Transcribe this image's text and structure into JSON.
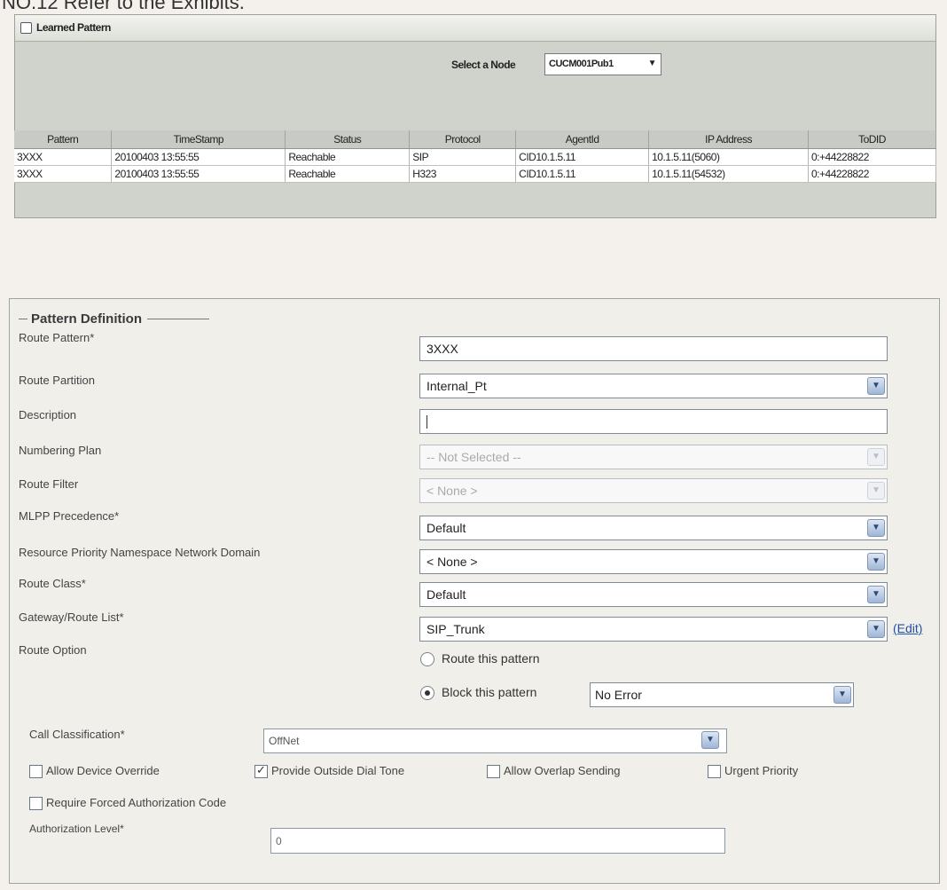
{
  "caption": "NO.12 Refer to the Exhibits.",
  "learned_pattern": {
    "title": "Learned Pattern",
    "node_label": "Select a Node",
    "node_value": "CUCM001Pub1",
    "columns": [
      "Pattern",
      "TimeStamp",
      "Status",
      "Protocol",
      "AgentId",
      "IP Address",
      "ToDID"
    ],
    "rows": [
      [
        "3XXX",
        "20100403 13:55:55",
        "Reachable",
        "SIP",
        "CID10.1.5.11",
        "10.1.5.11(5060)",
        "0:+44228822"
      ],
      [
        "3XXX",
        "20100403 13:55:55",
        "Reachable",
        "H323",
        "CID10.1.5.11",
        "10.1.5.11(54532)",
        "0:+44228822"
      ]
    ]
  },
  "pattern_definition": {
    "legend": "Pattern Definition",
    "fields": {
      "route_pattern": {
        "label": "Route Pattern*",
        "value": "3XXX"
      },
      "route_partition": {
        "label": "Route Partition",
        "value": "Internal_Pt"
      },
      "description": {
        "label": "Description",
        "value": ""
      },
      "numbering_plan": {
        "label": "Numbering Plan",
        "value": "-- Not Selected --"
      },
      "route_filter": {
        "label": "Route Filter",
        "value": "< None >"
      },
      "mlpp_precedence": {
        "label": "MLPP Precedence*",
        "value": "Default"
      },
      "resource_priority": {
        "label": "Resource Priority Namespace Network Domain",
        "value": "< None >"
      },
      "route_class": {
        "label": "Route Class*",
        "value": "Default"
      },
      "gateway_route_list": {
        "label": "Gateway/Route List*",
        "value": "SIP_Trunk",
        "edit_link": "(Edit)"
      }
    },
    "route_option": {
      "label": "Route Option",
      "route_label": "Route this pattern",
      "block_label": "Block this pattern",
      "block_reason": "No Error",
      "selected": "block"
    },
    "call_classification": {
      "label": "Call Classification*",
      "value": "OffNet"
    },
    "checkboxes": [
      {
        "label": "Allow Device Override",
        "checked": false
      },
      {
        "label": "Provide Outside Dial Tone",
        "checked": true
      },
      {
        "label": "Allow Overlap Sending",
        "checked": false
      },
      {
        "label": "Urgent Priority",
        "checked": false
      },
      {
        "label": "Require Forced Authorization Code",
        "checked": false
      }
    ],
    "authorization_level": {
      "label": "Authorization Level*",
      "value": "0"
    }
  }
}
